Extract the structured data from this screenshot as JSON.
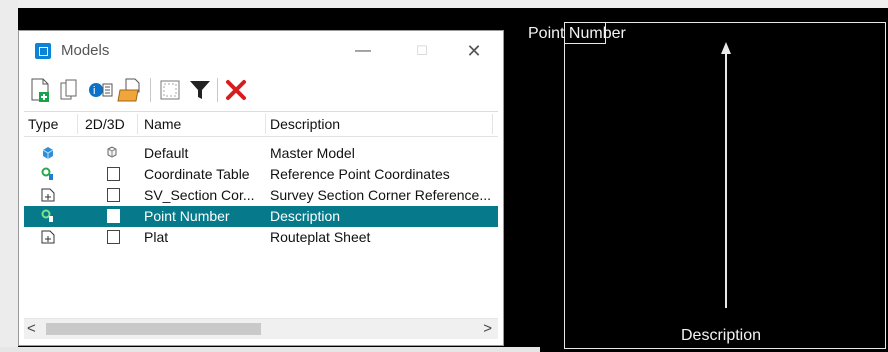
{
  "dialog": {
    "title": "Models",
    "controls": {
      "minimize": "—",
      "maximize": "☐",
      "close": "✕"
    }
  },
  "toolbar": {
    "icons": [
      "new-model-icon",
      "copy-model-icon",
      "model-properties-icon",
      "import-model-icon",
      "frame-icon",
      "filter-icon",
      "delete-icon"
    ]
  },
  "table": {
    "headers": {
      "type": "Type",
      "dim": "2D/3D",
      "name": "Name",
      "description": "Description"
    },
    "rows": [
      {
        "type_icon": "default-model-icon",
        "name": "Default",
        "description": "Master Model",
        "selected": false
      },
      {
        "type_icon": "coordinate-table-icon",
        "name": "Coordinate Table",
        "description": "Reference Point Coordinates",
        "selected": false
      },
      {
        "type_icon": "sheet-model-icon",
        "name": "SV_Section Cor...",
        "description": "Survey Section Corner Reference...",
        "selected": false
      },
      {
        "type_icon": "point-number-icon",
        "name": "Point Number",
        "description": "Description",
        "selected": true
      },
      {
        "type_icon": "sheet-model-icon",
        "name": "Plat",
        "description": "Routeplat Sheet",
        "selected": false
      }
    ]
  },
  "scrollbar": {
    "left": "<",
    "right": ">"
  },
  "canvas": {
    "top_label": "Point Number",
    "bottom_label": "Description"
  },
  "colors": {
    "selection": "#067a8a",
    "canvas_bg": "#000000",
    "delete": "#d71e1e"
  }
}
